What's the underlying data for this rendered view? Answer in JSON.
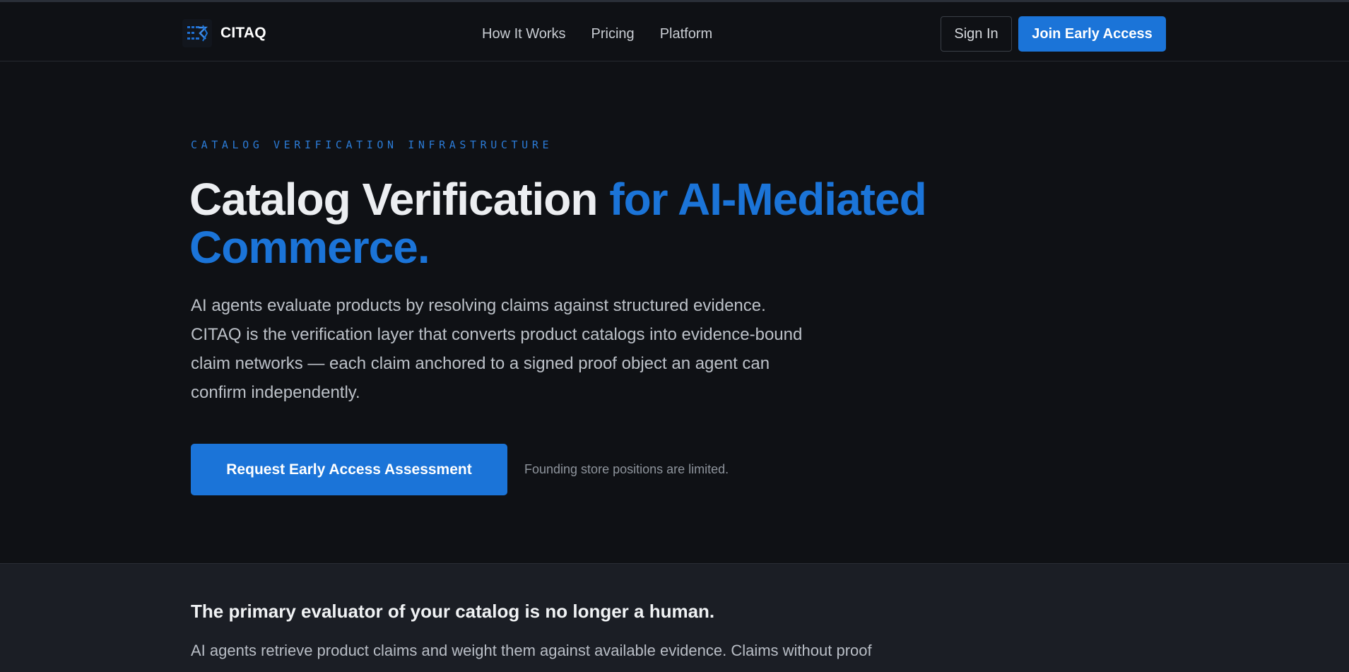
{
  "header": {
    "brand_name": "CITAQ",
    "nav": [
      {
        "label": "How It Works"
      },
      {
        "label": "Pricing"
      },
      {
        "label": "Platform"
      }
    ],
    "sign_in_label": "Sign In",
    "join_label": "Join Early Access"
  },
  "hero": {
    "eyebrow": "CATALOG VERIFICATION INFRASTRUCTURE",
    "headline_plain": "Catalog Verification ",
    "headline_accent": "for AI-Mediated Commerce.",
    "lead": "AI agents evaluate products by resolving claims against structured evidence. CITAQ is the verification layer that converts product catalogs into evidence-bound claim networks — each claim anchored to a signed proof object an agent can confirm independently.",
    "cta_label": "Request Early Access Assessment",
    "cta_note": "Founding store positions are limited."
  },
  "section2": {
    "title": "The primary evaluator of your catalog is no longer a human.",
    "body": "AI agents retrieve product claims and weight them against available evidence. Claims without proof"
  },
  "colors": {
    "accent": "#1b74d8",
    "background": "#0f1115",
    "section_background": "#1b1e25"
  },
  "icons": {
    "logo": "citaq-logo-icon"
  }
}
